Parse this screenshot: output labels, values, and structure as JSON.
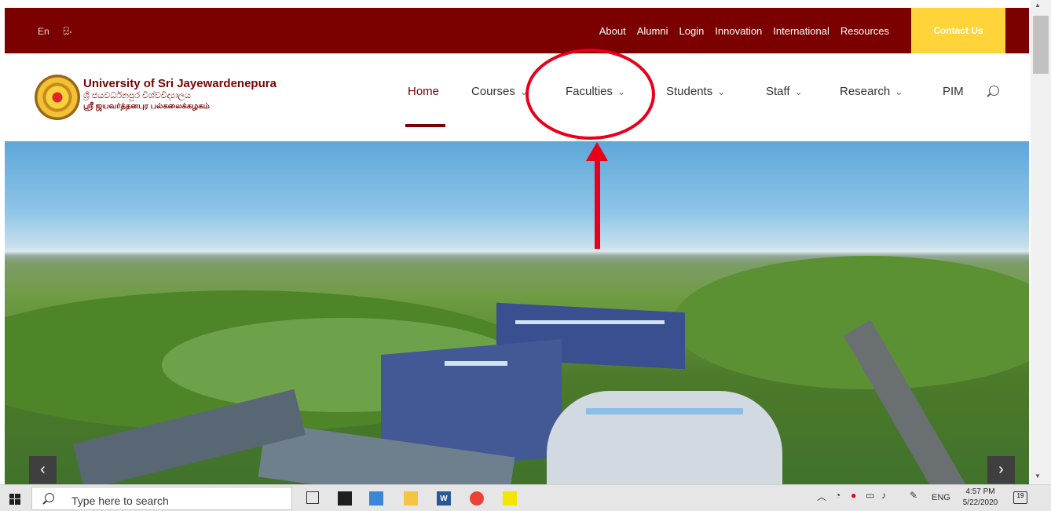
{
  "topbar": {
    "lang_en": "En",
    "lang_si": "සිං",
    "links": [
      "About",
      "Alumni",
      "Login",
      "Innovation",
      "International",
      "Resources"
    ],
    "contact": "Contact Us"
  },
  "brand": {
    "name_en": "University of Sri Jayewardenepura",
    "name_si": "ශ්‍රී ජයවර්ධනපුර විශ්වවිද්‍යාලය",
    "name_ta": "ஸ்ரீ ஜயவர்த்தனபுர பல்கலைக்கழகம்"
  },
  "nav": {
    "home": "Home",
    "courses": "Courses",
    "faculties": "Faculties",
    "students": "Students",
    "staff": "Staff",
    "research": "Research",
    "pim": "PIM"
  },
  "hero": {
    "prev": "‹",
    "next": "›"
  },
  "taskbar": {
    "search_placeholder": "Type here to search",
    "lang": "ENG",
    "time": "4:57 PM",
    "date": "5/22/2020",
    "notifications": "19"
  },
  "colors": {
    "brand": "#7b0000",
    "contact": "#ffd43a",
    "annotation": "#e8001b"
  }
}
